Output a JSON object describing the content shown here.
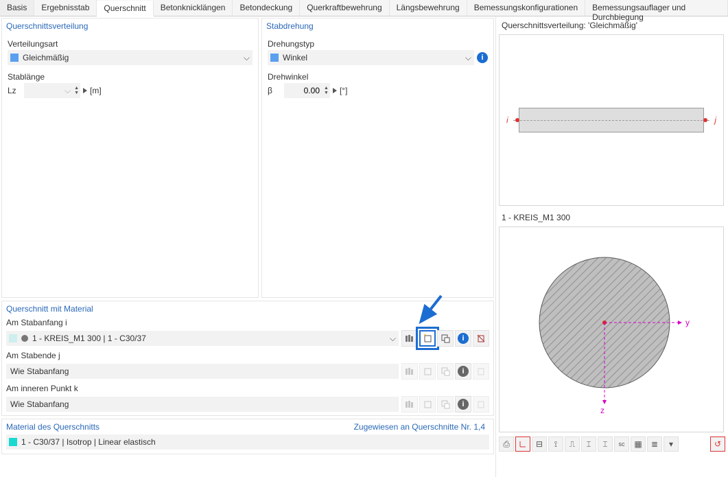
{
  "tabs": [
    "Basis",
    "Ergebnisstab",
    "Querschnitt",
    "Betonknicklängen",
    "Betondeckung",
    "Querkraftbewehrung",
    "Längsbewehrung",
    "Bemessungskonfigurationen",
    "Bemessungsauflager und Durchbiegung"
  ],
  "active_tab_index": 2,
  "distribution": {
    "title": "Querschnittsverteilung",
    "type_label": "Verteilungsart",
    "type_value": "Gleichmäßig",
    "length_label": "Stablänge",
    "length_symbol": "Lz",
    "length_value": "",
    "length_unit": "[m]"
  },
  "rotation": {
    "title": "Stabdrehung",
    "type_label": "Drehungstyp",
    "type_value": "Winkel",
    "angle_label": "Drehwinkel",
    "angle_symbol": "β",
    "angle_value": "0.00",
    "angle_unit": "[°]"
  },
  "cross_section": {
    "title": "Querschnitt mit Material",
    "start_label": "Am Stabanfang i",
    "start_value": "1 - KREIS_M1 300 | 1 - C30/37",
    "end_label": "Am Stabende j",
    "end_value": "Wie Stabanfang",
    "inner_label": "Am inneren Punkt k",
    "inner_value": "Wie Stabanfang"
  },
  "material": {
    "title": "Material des Querschnitts",
    "assigned_text": "Zugewiesen an Querschnitte Nr. 1,4",
    "value": "1 - C30/37 | Isotrop | Linear elastisch"
  },
  "preview": {
    "top_title": "Querschnittsverteilung: 'Gleichmäßig'",
    "bot_title": "1 - KREIS_M1 300",
    "i_label": "i",
    "j_label": "j",
    "y_label": "y",
    "z_label": "z"
  },
  "icons": {
    "library": "lib",
    "new": "new",
    "edit": "ed",
    "info": "i",
    "delete": "del"
  }
}
